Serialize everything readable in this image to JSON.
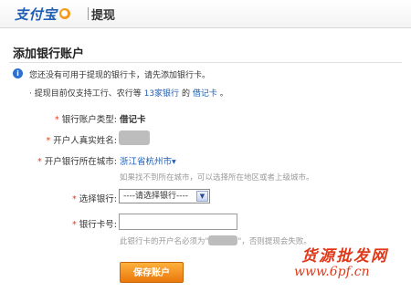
{
  "header": {
    "logo_text": "支付宝",
    "module_title": "提现"
  },
  "section": {
    "title": "添加银行账户"
  },
  "notice": {
    "line1": "您还没有可用于提现的银行卡，请先添加银行卡。",
    "line2_prefix": "· 提现目前仅支持工行、农行等",
    "line2_link": "13家银行",
    "line2_middle": "的",
    "line2_link2": "借记卡",
    "line2_suffix": "。"
  },
  "form": {
    "required_mark": "*",
    "account_type_label": "银行账户类型:",
    "account_type_value": "借记卡",
    "real_name_label": "开户人真实姓名:",
    "city_label": "开户银行所在城市:",
    "city_value": "浙江省杭州市▾",
    "city_hint": "如果找不到所在城市，可以选择所在地区或者上级城市。",
    "bank_label": "选择银行:",
    "bank_select_value": "----请选择银行----",
    "card_label": "银行卡号:",
    "card_hint_prefix": "此银行卡的开户名必须为\"",
    "card_hint_suffix": "\"，否则提现会失败。",
    "card_value": "",
    "save_label": "保存账户"
  },
  "watermark": {
    "line1": "货源批发网",
    "line2": "www.6pf.cn"
  },
  "colors": {
    "brand_blue": "#1f5fb5",
    "required_red": "#e03c1f",
    "button_orange": "#f08c1f"
  }
}
